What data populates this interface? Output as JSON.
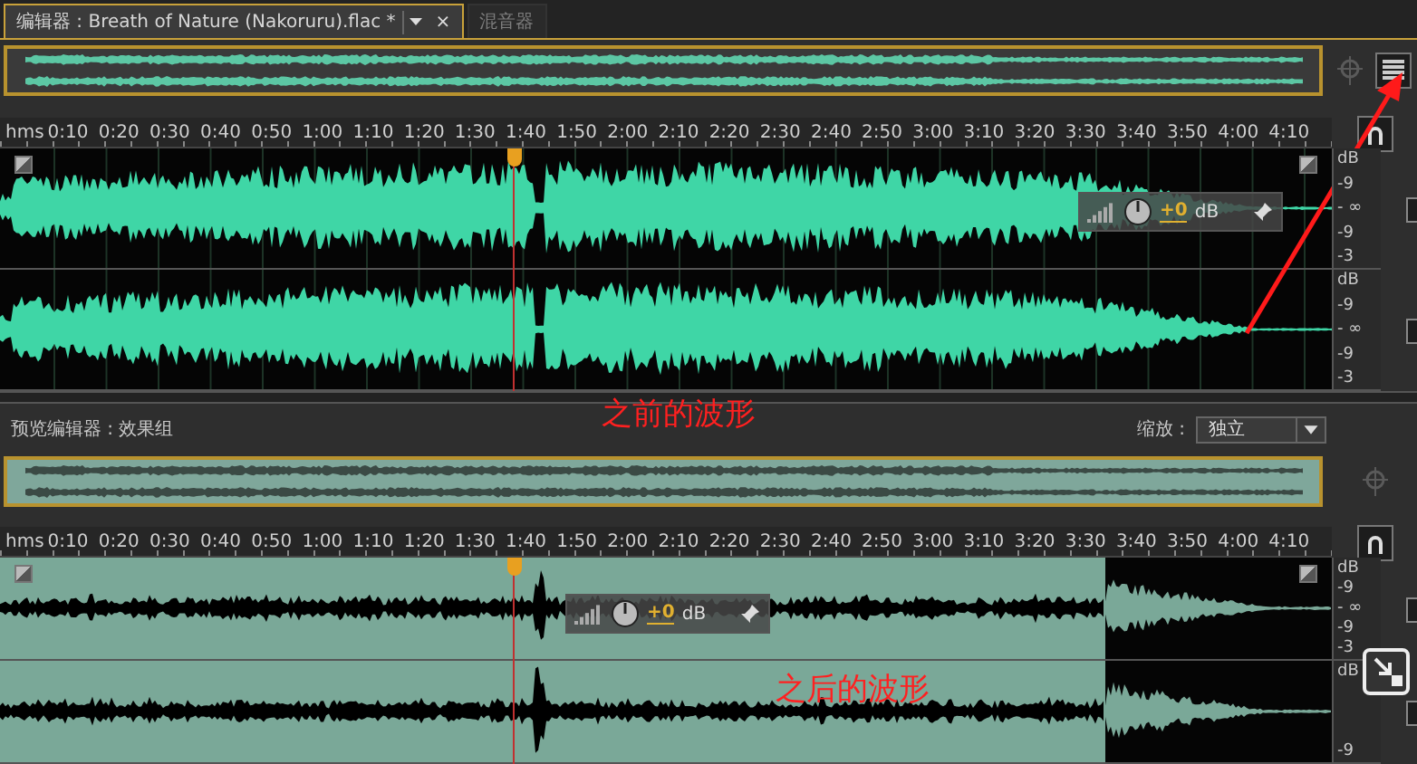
{
  "tabs": [
    {
      "label": "编辑器 : Breath of Nature (Nakoruru).flac *",
      "selected": true,
      "close": "×"
    },
    {
      "label": "混音器",
      "selected": false
    }
  ],
  "editor": {
    "ruler": {
      "unit": "hms",
      "labels": [
        "0:10",
        "0:20",
        "0:30",
        "0:40",
        "0:50",
        "1:00",
        "1:10",
        "1:20",
        "1:30",
        "1:40",
        "1:50",
        "2:00",
        "2:10",
        "2:20",
        "2:30",
        "2:40",
        "2:50",
        "3:00",
        "3:10",
        "3:20",
        "3:30",
        "3:40",
        "3:50",
        "4:00",
        "4:10"
      ]
    },
    "channels": [
      {
        "scale": [
          "dB",
          "-9",
          "- ∞",
          "-9",
          "-3"
        ]
      },
      {
        "scale": [
          "dB",
          "-9",
          "- ∞",
          "-9",
          "-3"
        ]
      }
    ],
    "hud": {
      "gain": "+0",
      "unit": "dB"
    },
    "annotation": "之前的波形"
  },
  "preview": {
    "title": "预览编辑器 : 效果组",
    "zoom_label": "缩放 :",
    "zoom_value": "独立",
    "ruler": {
      "unit": "hms",
      "labels": [
        "0:10",
        "0:20",
        "0:30",
        "0:40",
        "0:50",
        "1:00",
        "1:10",
        "1:20",
        "1:30",
        "1:40",
        "1:50",
        "2:00",
        "2:10",
        "2:20",
        "2:30",
        "2:40",
        "2:50",
        "3:00",
        "3:10",
        "3:20",
        "3:30",
        "3:40",
        "3:50",
        "4:00",
        "4:10"
      ]
    },
    "channels": [
      {
        "scale": [
          "dB",
          "-9",
          "- ∞",
          "-9",
          "-3"
        ]
      },
      {
        "scale": [
          "dB",
          "-9"
        ]
      }
    ],
    "hud": {
      "gain": "+0",
      "unit": "dB"
    },
    "annotation": "之后的波形"
  }
}
